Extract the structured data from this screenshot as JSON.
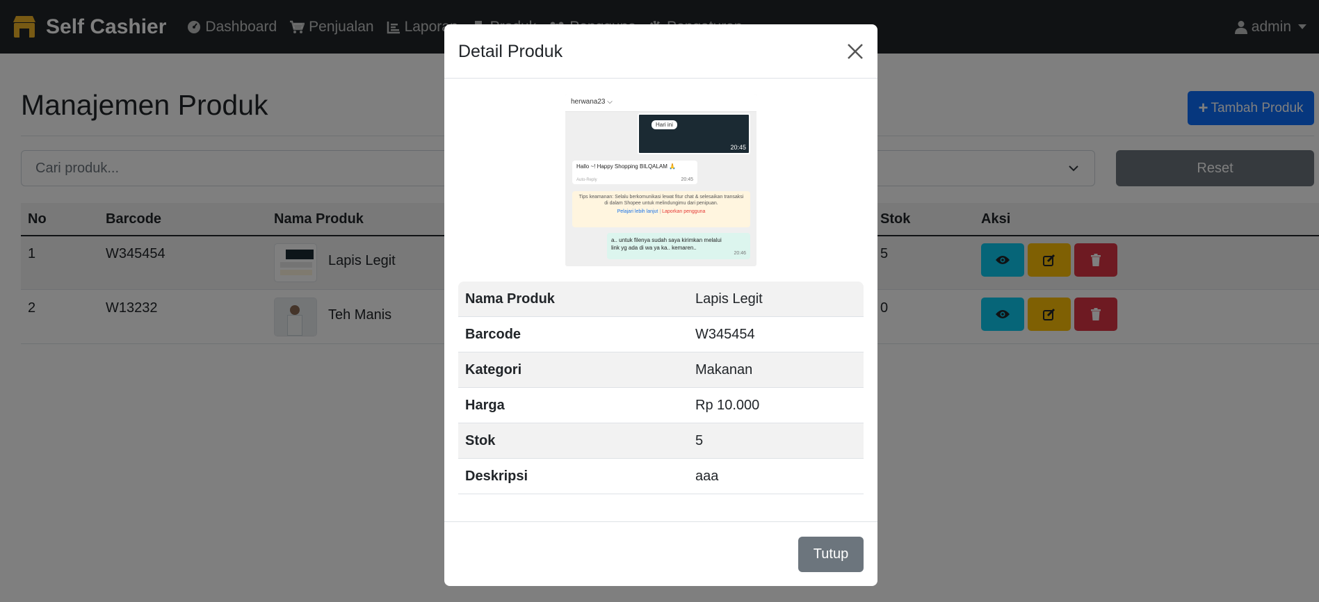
{
  "navbar": {
    "brand": "Self Cashier",
    "items": [
      {
        "label": "Dashboard",
        "icon": "gauge-icon"
      },
      {
        "label": "Penjualan",
        "icon": "cart-icon"
      },
      {
        "label": "Laporan",
        "icon": "chart-icon"
      },
      {
        "label": "Produk",
        "icon": "boxes-icon"
      },
      {
        "label": "Pengguna",
        "icon": "users-icon"
      },
      {
        "label": "Pengaturan",
        "icon": "gear-icon"
      }
    ],
    "user": "admin"
  },
  "page": {
    "title": "Manajemen Produk",
    "add_button": "Tambah Produk",
    "search_placeholder": "Cari produk...",
    "reset_button": "Reset"
  },
  "table": {
    "headers": [
      "No",
      "Barcode",
      "Nama Produk",
      "Stok",
      "Aksi"
    ],
    "rows": [
      {
        "no": "1",
        "barcode": "W345454",
        "name": "Lapis Legit",
        "stok": "5"
      },
      {
        "no": "2",
        "barcode": "W13232",
        "name": "Teh Manis",
        "stok": "0"
      }
    ]
  },
  "modal": {
    "title": "Detail Produk",
    "image": {
      "username": "herwana23",
      "badge": "Hari ini",
      "video_time": "20:45",
      "greeting": "Hallo ~! Happy Shopping BILQALAM 🙏",
      "greeting_sub": "Auto-Reply",
      "greeting_time": "20:45",
      "tips": "Tips keamanan: Selalu berkomunikasi lewat fitur chat & selesaikan transaksi di dalam Shopee untuk melindungimu dari penipuan.",
      "tips_link1": "Pelajari lebih lanjut",
      "tips_link2": "Laporkan pengguna",
      "reply": "a.. untuk filenya sudah saya kirimkan melalui link yg ada di wa ya ka.. kemaren..",
      "reply_time": "20:46"
    },
    "details": [
      {
        "label": "Nama Produk",
        "value": "Lapis Legit"
      },
      {
        "label": "Barcode",
        "value": "W345454"
      },
      {
        "label": "Kategori",
        "value": "Makanan"
      },
      {
        "label": "Harga",
        "value": "Rp 10.000"
      },
      {
        "label": "Stok",
        "value": "5"
      },
      {
        "label": "Deskripsi",
        "value": "aaa"
      }
    ],
    "close_button": "Tutup"
  }
}
